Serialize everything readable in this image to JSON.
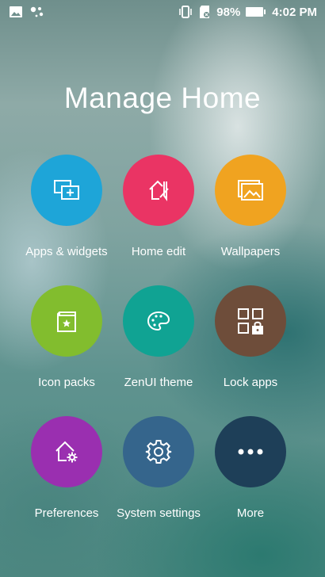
{
  "status_bar": {
    "battery": "98%",
    "time": "4:02 PM",
    "icons": [
      "gallery-icon",
      "assistant-icon",
      "vibrate-icon",
      "sd-card-icon",
      "battery-icon"
    ]
  },
  "title": "Manage Home",
  "tiles": [
    {
      "label": "Apps & widgets",
      "color": "#1ea5d8",
      "icon": "apps-widgets-icon"
    },
    {
      "label": "Home edit",
      "color": "#ea3464",
      "icon": "home-edit-icon"
    },
    {
      "label": "Wallpapers",
      "color": "#f0a320",
      "icon": "wallpapers-icon"
    },
    {
      "label": "Icon packs",
      "color": "#82bd2e",
      "icon": "icon-packs-icon"
    },
    {
      "label": "ZenUI theme",
      "color": "#10a393",
      "icon": "palette-icon"
    },
    {
      "label": "Lock apps",
      "color": "#6e4d3a",
      "icon": "lock-apps-icon"
    },
    {
      "label": "Preferences",
      "color": "#9a2fb0",
      "icon": "home-settings-icon"
    },
    {
      "label": "System settings",
      "color": "#35658c",
      "icon": "gear-icon"
    },
    {
      "label": "More",
      "color": "#1e3f58",
      "icon": "more-dots-icon"
    }
  ]
}
